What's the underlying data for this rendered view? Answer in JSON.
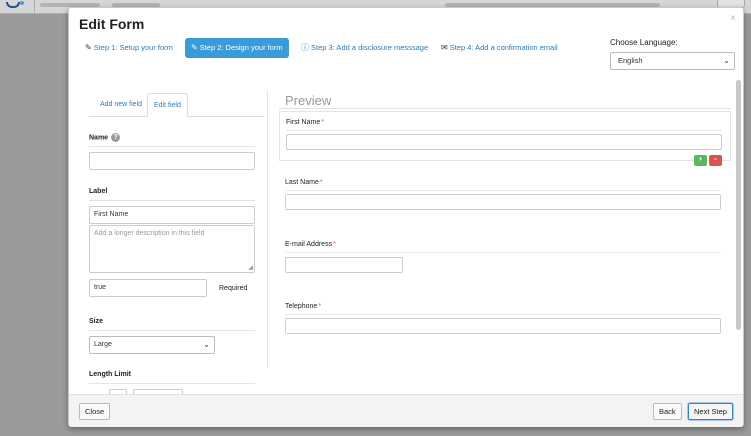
{
  "background": {
    "logo": "partner-logo",
    "topbar_items": [
      "",
      "",
      ""
    ]
  },
  "modal": {
    "title": "Edit Form",
    "close_symbol": "×"
  },
  "steps": [
    {
      "icon": "wrench-icon",
      "glyph": "✎",
      "label": "Step 1: Setup your form"
    },
    {
      "icon": "pencil-icon",
      "glyph": "✎",
      "label": "Step 2: Design your form",
      "active": true
    },
    {
      "icon": "info-icon",
      "glyph": "ⓘ",
      "label": "Step 3: Add a disclosure messsage"
    },
    {
      "icon": "envelope-icon",
      "glyph": "✉",
      "label": "Step 4: Add a confirmation email"
    }
  ],
  "language": {
    "label": "Choose Language:",
    "value": "English"
  },
  "left": {
    "tabs": [
      "Add new field",
      "Edit field"
    ],
    "name_label": "Name",
    "name_value": "",
    "label_label": "Label",
    "label_value": "First Name",
    "description_placeholder": "Add a longer description in this field",
    "required_value": "true",
    "required_label": "Required",
    "size_label": "Size",
    "size_value": "Large",
    "length_label": "Length Limit"
  },
  "preview": {
    "title": "Preview",
    "required_mark": "*",
    "fields": [
      {
        "label": "First Name"
      },
      {
        "label": "Last Name"
      },
      {
        "label": "E-mail Address"
      },
      {
        "label": "Telephone"
      }
    ],
    "add_symbol": "+",
    "remove_symbol": "−"
  },
  "footer": {
    "close": "Close",
    "back": "Back",
    "next": "Next Step"
  },
  "colors": {
    "accent": "#3b9ad8",
    "link": "#2a7bbf",
    "success": "#5cb85c",
    "danger": "#d9534f"
  }
}
